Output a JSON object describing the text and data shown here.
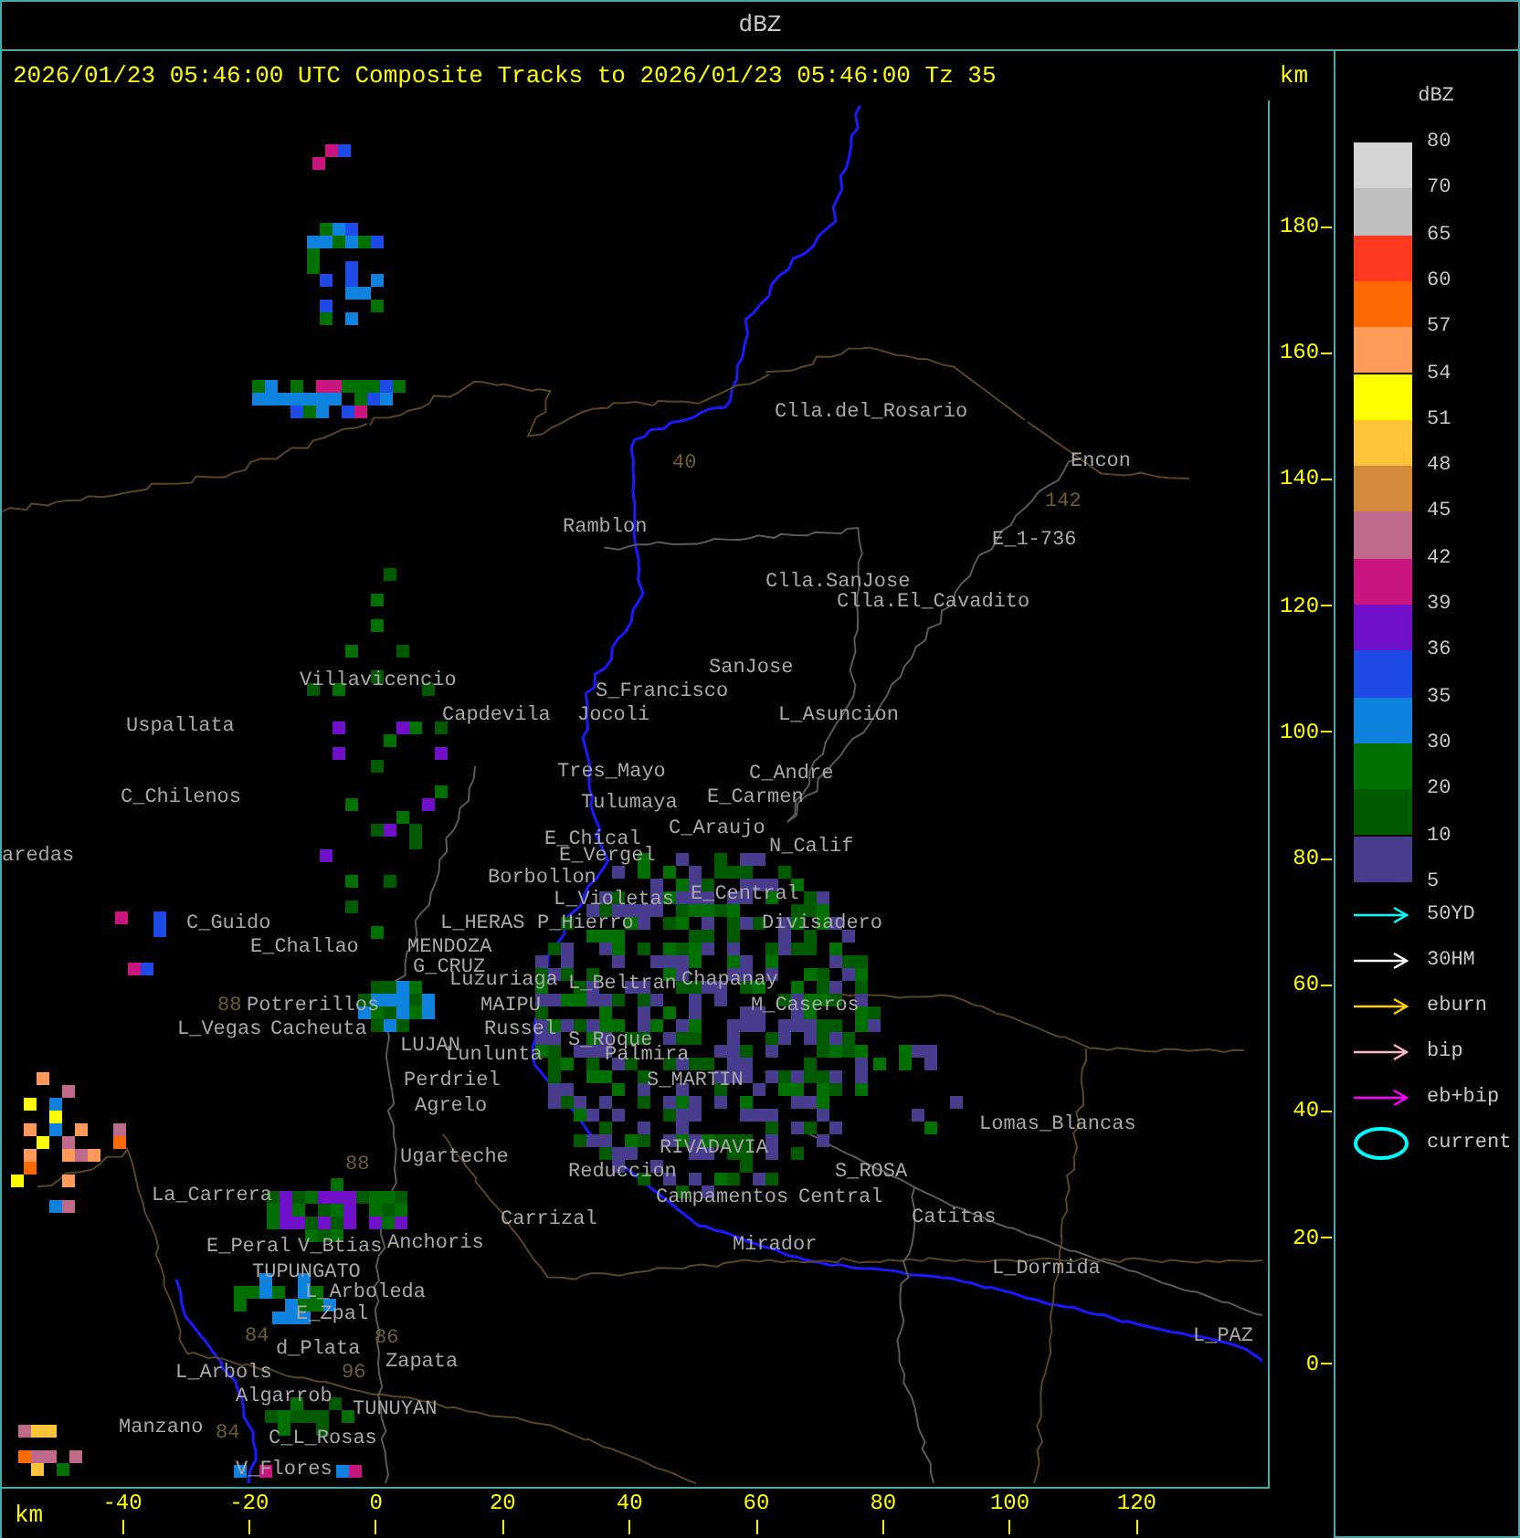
{
  "title": "dBZ",
  "header": {
    "text": "2026/01/23 05:46:00 UTC Composite Tracks to 2026/01/23 05:46:00 Tz 35",
    "unit": "km"
  },
  "map": {
    "labels": [
      {
        "name": "Clla.del_Rosario",
        "kind": "place"
      },
      {
        "name": "40",
        "kind": "route"
      },
      {
        "name": "Encon",
        "kind": "place"
      },
      {
        "name": "142",
        "kind": "route"
      },
      {
        "name": "Ramblon",
        "kind": "place"
      },
      {
        "name": "E_1-736",
        "kind": "place"
      },
      {
        "name": "Clla.SanJose",
        "kind": "place"
      },
      {
        "name": "Clla.El_Cavadito",
        "kind": "place"
      },
      {
        "name": "Villavicencio",
        "kind": "place"
      },
      {
        "name": "SanJose",
        "kind": "place"
      },
      {
        "name": "S_Francisco",
        "kind": "place"
      },
      {
        "name": "Uspallata",
        "kind": "place"
      },
      {
        "name": "Capdevila",
        "kind": "place"
      },
      {
        "name": "Jocoli",
        "kind": "place"
      },
      {
        "name": "L_Asuncion",
        "kind": "place"
      },
      {
        "name": "Tres_Mayo",
        "kind": "place"
      },
      {
        "name": "C_Andre",
        "kind": "place"
      },
      {
        "name": "C_Chilenos",
        "kind": "place"
      },
      {
        "name": "Tulumaya",
        "kind": "place"
      },
      {
        "name": "E_Carmen",
        "kind": "place"
      },
      {
        "name": "E_Chical",
        "kind": "place"
      },
      {
        "name": "C_Araujo",
        "kind": "place"
      },
      {
        "name": "aredas",
        "kind": "place"
      },
      {
        "name": "E_Vergel",
        "kind": "place"
      },
      {
        "name": "N_Calif",
        "kind": "place"
      },
      {
        "name": "Borbollon",
        "kind": "place"
      },
      {
        "name": "L_Violetas",
        "kind": "place"
      },
      {
        "name": "E_Central",
        "kind": "place"
      },
      {
        "name": "C_Guido",
        "kind": "place"
      },
      {
        "name": "L_HERAS",
        "kind": "place"
      },
      {
        "name": "P_Hierro",
        "kind": "place"
      },
      {
        "name": "Divisadero",
        "kind": "place"
      },
      {
        "name": "E_Challao",
        "kind": "place"
      },
      {
        "name": "MENDOZA",
        "kind": "place"
      },
      {
        "name": "G_CRUZ",
        "kind": "place"
      },
      {
        "name": "Luzuriaga",
        "kind": "place"
      },
      {
        "name": "L_Beltran",
        "kind": "place"
      },
      {
        "name": "Chapanay",
        "kind": "place"
      },
      {
        "name": "88",
        "kind": "route"
      },
      {
        "name": "Potrerillos",
        "kind": "place"
      },
      {
        "name": "MAIPU",
        "kind": "place"
      },
      {
        "name": "M_Caseros",
        "kind": "place"
      },
      {
        "name": "L_Vegas",
        "kind": "place"
      },
      {
        "name": "Cacheuta",
        "kind": "place"
      },
      {
        "name": "LUJAN",
        "kind": "place"
      },
      {
        "name": "Russel",
        "kind": "place"
      },
      {
        "name": "Lunlunta",
        "kind": "place"
      },
      {
        "name": "S_Roque",
        "kind": "place"
      },
      {
        "name": "Palmira",
        "kind": "place"
      },
      {
        "name": "Perdriel",
        "kind": "place"
      },
      {
        "name": "S_MARTIN",
        "kind": "place"
      },
      {
        "name": "Agrelo",
        "kind": "place"
      },
      {
        "name": "Lomas_Blancas",
        "kind": "place"
      },
      {
        "name": "88",
        "kind": "route"
      },
      {
        "name": "Ugarteche",
        "kind": "place"
      },
      {
        "name": "Reduccion",
        "kind": "place"
      },
      {
        "name": "RIVADAVIA",
        "kind": "place"
      },
      {
        "name": "S_ROSA",
        "kind": "place"
      },
      {
        "name": "La_Carrera",
        "kind": "place"
      },
      {
        "name": "Campamentos",
        "kind": "place"
      },
      {
        "name": "Central",
        "kind": "place"
      },
      {
        "name": "Carrizal",
        "kind": "place"
      },
      {
        "name": "Catitas",
        "kind": "place"
      },
      {
        "name": "E_Peral",
        "kind": "place"
      },
      {
        "name": "V_Btias",
        "kind": "place"
      },
      {
        "name": "Anchoris",
        "kind": "place"
      },
      {
        "name": "Mirador",
        "kind": "place"
      },
      {
        "name": "TUPUNGATO",
        "kind": "place"
      },
      {
        "name": "L_Dormida",
        "kind": "place"
      },
      {
        "name": "L_Arboleda",
        "kind": "place"
      },
      {
        "name": "E_Zpal",
        "kind": "place"
      },
      {
        "name": "84",
        "kind": "route"
      },
      {
        "name": "d_Plata",
        "kind": "place"
      },
      {
        "name": "86",
        "kind": "route"
      },
      {
        "name": "L_PAZ",
        "kind": "place"
      },
      {
        "name": "L_Arbols",
        "kind": "place"
      },
      {
        "name": "96",
        "kind": "route"
      },
      {
        "name": "Zapata",
        "kind": "place"
      },
      {
        "name": "Algarrob",
        "kind": "place"
      },
      {
        "name": "Manzano",
        "kind": "place"
      },
      {
        "name": "TUNUYAN",
        "kind": "place"
      },
      {
        "name": "84",
        "kind": "route"
      },
      {
        "name": "C_L_Rosas",
        "kind": "place"
      },
      {
        "name": "V_Flores",
        "kind": "place"
      }
    ]
  },
  "y_axis": {
    "ticks": [
      "180",
      "160",
      "140",
      "120",
      "100",
      "80",
      "60",
      "40",
      "20",
      "0"
    ]
  },
  "x_axis": {
    "unit": "km",
    "ticks": [
      "-40",
      "-20",
      "0",
      "20",
      "40",
      "60",
      "80",
      "100",
      "120"
    ]
  },
  "legend": {
    "title": "dBZ",
    "bands": [
      {
        "label": "80",
        "color": "#d4d4d4"
      },
      {
        "label": "70",
        "color": "#bebebe"
      },
      {
        "label": "65",
        "color": "#ff3a22"
      },
      {
        "label": "60",
        "color": "#ff6a00"
      },
      {
        "label": "57",
        "color": "#ff9a5a"
      },
      {
        "label": "54",
        "color": "#ffff00"
      },
      {
        "label": "51",
        "color": "#ffc43a"
      },
      {
        "label": "48",
        "color": "#d2893c"
      },
      {
        "label": "45",
        "color": "#bf6a8a"
      },
      {
        "label": "42",
        "color": "#c8167e"
      },
      {
        "label": "39",
        "color": "#7010c8"
      },
      {
        "label": "36",
        "color": "#1e4ae6"
      },
      {
        "label": "35",
        "color": "#0e82dc"
      },
      {
        "label": "30",
        "color": "#007000"
      },
      {
        "label": "20",
        "color": "#005a00"
      },
      {
        "label": "10",
        "color": "#483c8c"
      }
    ],
    "bottom_label": "5",
    "tracks": [
      {
        "label": "50YD",
        "kind": "arrow",
        "color": "#00ffff"
      },
      {
        "label": "30HM",
        "kind": "arrow",
        "color": "#ffffff"
      },
      {
        "label": "eburn",
        "kind": "arrow",
        "color": "#ffcc00"
      },
      {
        "label": "bip",
        "kind": "arrow",
        "color": "#ffb6c1"
      },
      {
        "label": "eb+bip",
        "kind": "arrow",
        "color": "#ff00ff"
      },
      {
        "label": "current",
        "kind": "ellipse",
        "color": "#00ffff"
      }
    ]
  }
}
